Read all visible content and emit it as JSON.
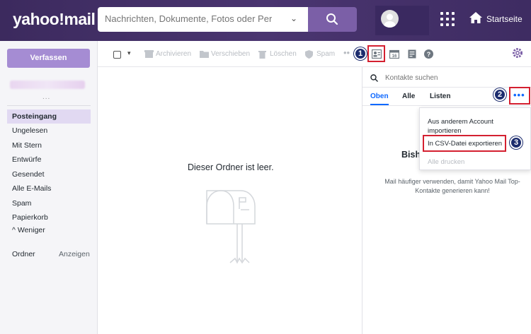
{
  "header": {
    "logo": "yahoo!mail",
    "search_placeholder": "Nachrichten, Dokumente, Fotos oder Personen suchen",
    "home_label": "Startseite"
  },
  "sidebar": {
    "compose_label": "Verfassen",
    "account_dots": "...",
    "items": [
      {
        "label": "Posteingang",
        "active": true
      },
      {
        "label": "Ungelesen"
      },
      {
        "label": "Mit Stern"
      },
      {
        "label": "Entwürfe"
      },
      {
        "label": "Gesendet"
      },
      {
        "label": "Alle E-Mails"
      },
      {
        "label": "Spam"
      },
      {
        "label": "Papierkorb"
      }
    ],
    "less_label": "^ Weniger",
    "folders_label": "Ordner",
    "folders_show": "Anzeigen"
  },
  "toolbar": {
    "archive": "Archivieren",
    "move": "Verschieben",
    "delete": "Löschen",
    "spam": "Spam",
    "more": "••"
  },
  "main": {
    "empty_text": "Dieser Ordner ist leer."
  },
  "contacts": {
    "search_placeholder": "Kontakte suchen",
    "tabs": [
      "Oben",
      "Alle",
      "Listen"
    ],
    "more": "•••",
    "heading_partial": "Bishe",
    "info": "Mail häufiger verwenden, damit Yahoo Mail Top-Kontakte generieren kann!",
    "menu": {
      "import": "Aus anderem Account importieren",
      "export_csv": "In CSV-Datei exportieren",
      "print_all": "Alle drucken"
    }
  },
  "annotations": {
    "badge1": "1",
    "badge2": "2",
    "badge3": "3"
  },
  "colors": {
    "accent": "#7b5fa7",
    "compose": "#a58cd3",
    "link": "#0f69ff",
    "highlight": "#d42030",
    "badge": "#1c2c6e"
  }
}
